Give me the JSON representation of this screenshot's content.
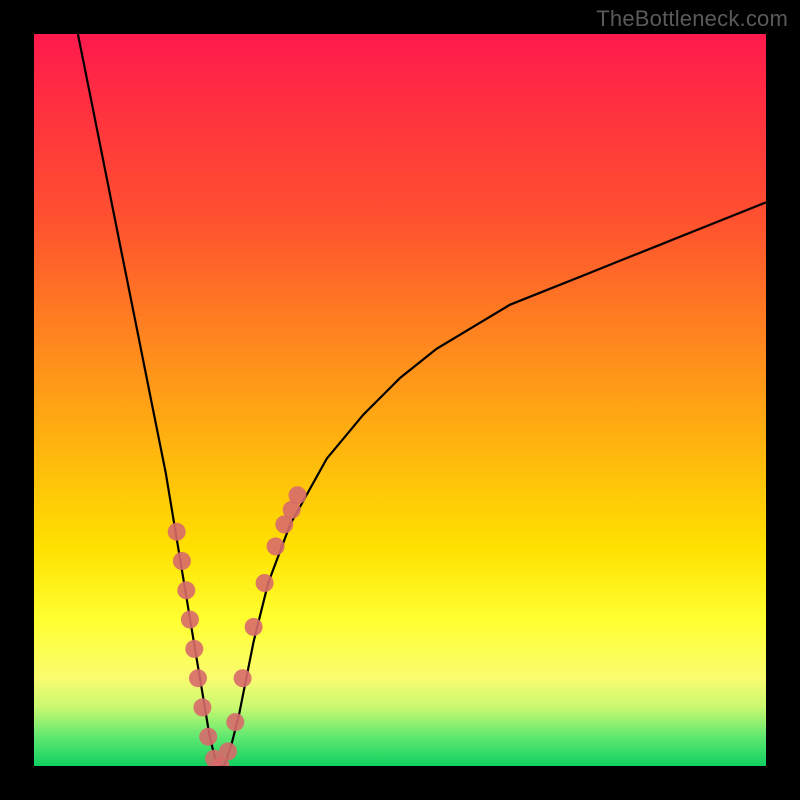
{
  "watermark": "TheBottleneck.com",
  "chart_data": {
    "type": "line",
    "title": "",
    "xlabel": "",
    "ylabel": "",
    "xlim": [
      0,
      100
    ],
    "ylim": [
      0,
      100
    ],
    "grid": false,
    "legend": false,
    "series": [
      {
        "name": "bottleneck-curve",
        "x": [
          6,
          8,
          10,
          12,
          14,
          16,
          18,
          20,
          21,
          22,
          23,
          24,
          25,
          26,
          27,
          28,
          29,
          30,
          32,
          35,
          40,
          45,
          50,
          55,
          60,
          65,
          70,
          75,
          80,
          85,
          90,
          95,
          100
        ],
        "y": [
          100,
          90,
          80,
          70,
          60,
          50,
          40,
          28,
          22,
          16,
          10,
          4,
          0,
          0,
          3,
          7,
          12,
          17,
          25,
          33,
          42,
          48,
          53,
          57,
          60,
          63,
          65,
          67,
          69,
          71,
          73,
          75,
          77
        ]
      }
    ],
    "markers": {
      "name": "highlight-dots",
      "color": "#d76a6a",
      "points_x": [
        19.5,
        20.2,
        20.8,
        21.3,
        21.9,
        22.4,
        23.0,
        23.8,
        24.6,
        25.5,
        26.5,
        27.5,
        28.5,
        30.0,
        31.5,
        33.0,
        34.2,
        35.2,
        36.0
      ],
      "points_y": [
        32,
        28,
        24,
        20,
        16,
        12,
        8,
        4,
        1,
        0,
        2,
        6,
        12,
        19,
        25,
        30,
        33,
        35,
        37
      ]
    }
  }
}
